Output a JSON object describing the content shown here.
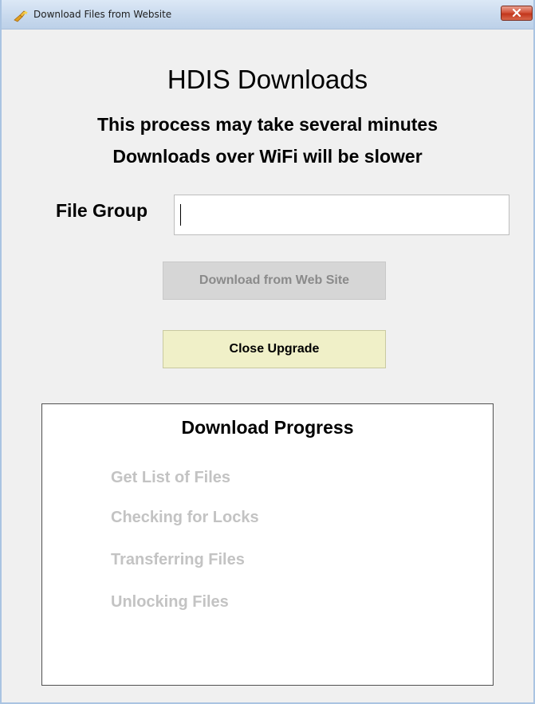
{
  "window": {
    "title": "Download Files from Website",
    "close_glyph": "✕"
  },
  "main": {
    "title": "HDIS Downloads",
    "subtitle_line1": "This process may take several minutes",
    "subtitle_line2": "Downloads over WiFi will be slower",
    "file_group": {
      "label": "File Group",
      "value": ""
    },
    "download_button_label": "Download from Web Site",
    "close_button_label": "Close Upgrade"
  },
  "progress": {
    "title": "Download Progress",
    "steps": [
      "Get List of Files",
      "Checking for Locks",
      "Transferring Files",
      "Unlocking Files"
    ]
  },
  "colors": {
    "window_background": "#f0f0f0",
    "close_button_background": "#f0f0c8",
    "disabled_button_background": "#d6d6d6",
    "inactive_step_text": "#c3c3c3"
  },
  "icons": {
    "app_icon": "hand-sparkle-icon",
    "close_icon": "close-icon"
  }
}
